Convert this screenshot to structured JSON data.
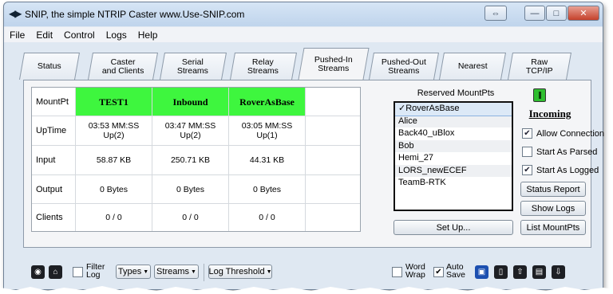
{
  "window": {
    "title": "SNIP, the simple NTRIP Caster   www.Use-SNIP.com",
    "app_icon": "double-arrow-icon",
    "caption_buttons": [
      "restore-icon",
      "minimize-icon",
      "maximize-icon",
      "close-icon"
    ]
  },
  "menu": [
    "File",
    "Edit",
    "Control",
    "Logs",
    "Help"
  ],
  "tabs": [
    {
      "label": "Status",
      "active": false
    },
    {
      "label": "Caster\nand Clients",
      "active": false
    },
    {
      "label": "Serial\nStreams",
      "active": false
    },
    {
      "label": "Relay\nStreams",
      "active": false
    },
    {
      "label": "Pushed-In\nStreams",
      "active": true
    },
    {
      "label": "Pushed-Out\nStreams",
      "active": false
    },
    {
      "label": "Nearest",
      "active": false
    },
    {
      "label": "Raw\nTCP/IP",
      "active": false
    }
  ],
  "streams_table": {
    "row_headers": [
      "MountPt",
      "UpTime",
      "Input",
      "Output",
      "Clients"
    ],
    "columns": [
      {
        "mountpt": "TEST1",
        "uptime": "03:53 MM:SS\nUp(2)",
        "input": "58.87 KB",
        "output": "0 Bytes",
        "clients": "0 / 0"
      },
      {
        "mountpt": "Inbound",
        "uptime": "03:47 MM:SS\nUp(2)",
        "input": "250.71 KB",
        "output": "0 Bytes",
        "clients": "0 / 0"
      },
      {
        "mountpt": "RoverAsBase",
        "uptime": "03:05 MM:SS\nUp(1)",
        "input": "44.31 KB",
        "output": "0 Bytes",
        "clients": "0 / 0"
      }
    ],
    "header_color": "#3ef63e"
  },
  "reserved": {
    "title": "Reserved MountPts",
    "items": [
      "✓RoverAsBase",
      "Alice",
      "Back40_uBlox",
      "Bob",
      "Hemi_27",
      "LORS_newECEF",
      "TeamB-RTK"
    ],
    "setup_label": "Set Up..."
  },
  "incoming": {
    "status_icon": "status-green-icon",
    "title": "Incoming",
    "checks": [
      {
        "label": "Allow Connection",
        "checked": true
      },
      {
        "label": "Start As Parsed",
        "checked": false
      },
      {
        "label": "Start As Logged",
        "checked": true
      }
    ],
    "buttons": [
      "Status Report",
      "Show Logs",
      "List MountPts"
    ]
  },
  "toolbar": {
    "filter_log": "Filter\nLog",
    "types": "Types",
    "streams": "Streams",
    "log_threshold": "Log Threshold",
    "word_wrap": "Word\nWrap",
    "word_wrap_checked": false,
    "auto_save": "Auto\nSave",
    "auto_save_checked": true,
    "icons": [
      "record-icon",
      "home-icon",
      "save-icon",
      "new-page-icon",
      "upload-icon",
      "file-icon",
      "download-icon"
    ]
  }
}
